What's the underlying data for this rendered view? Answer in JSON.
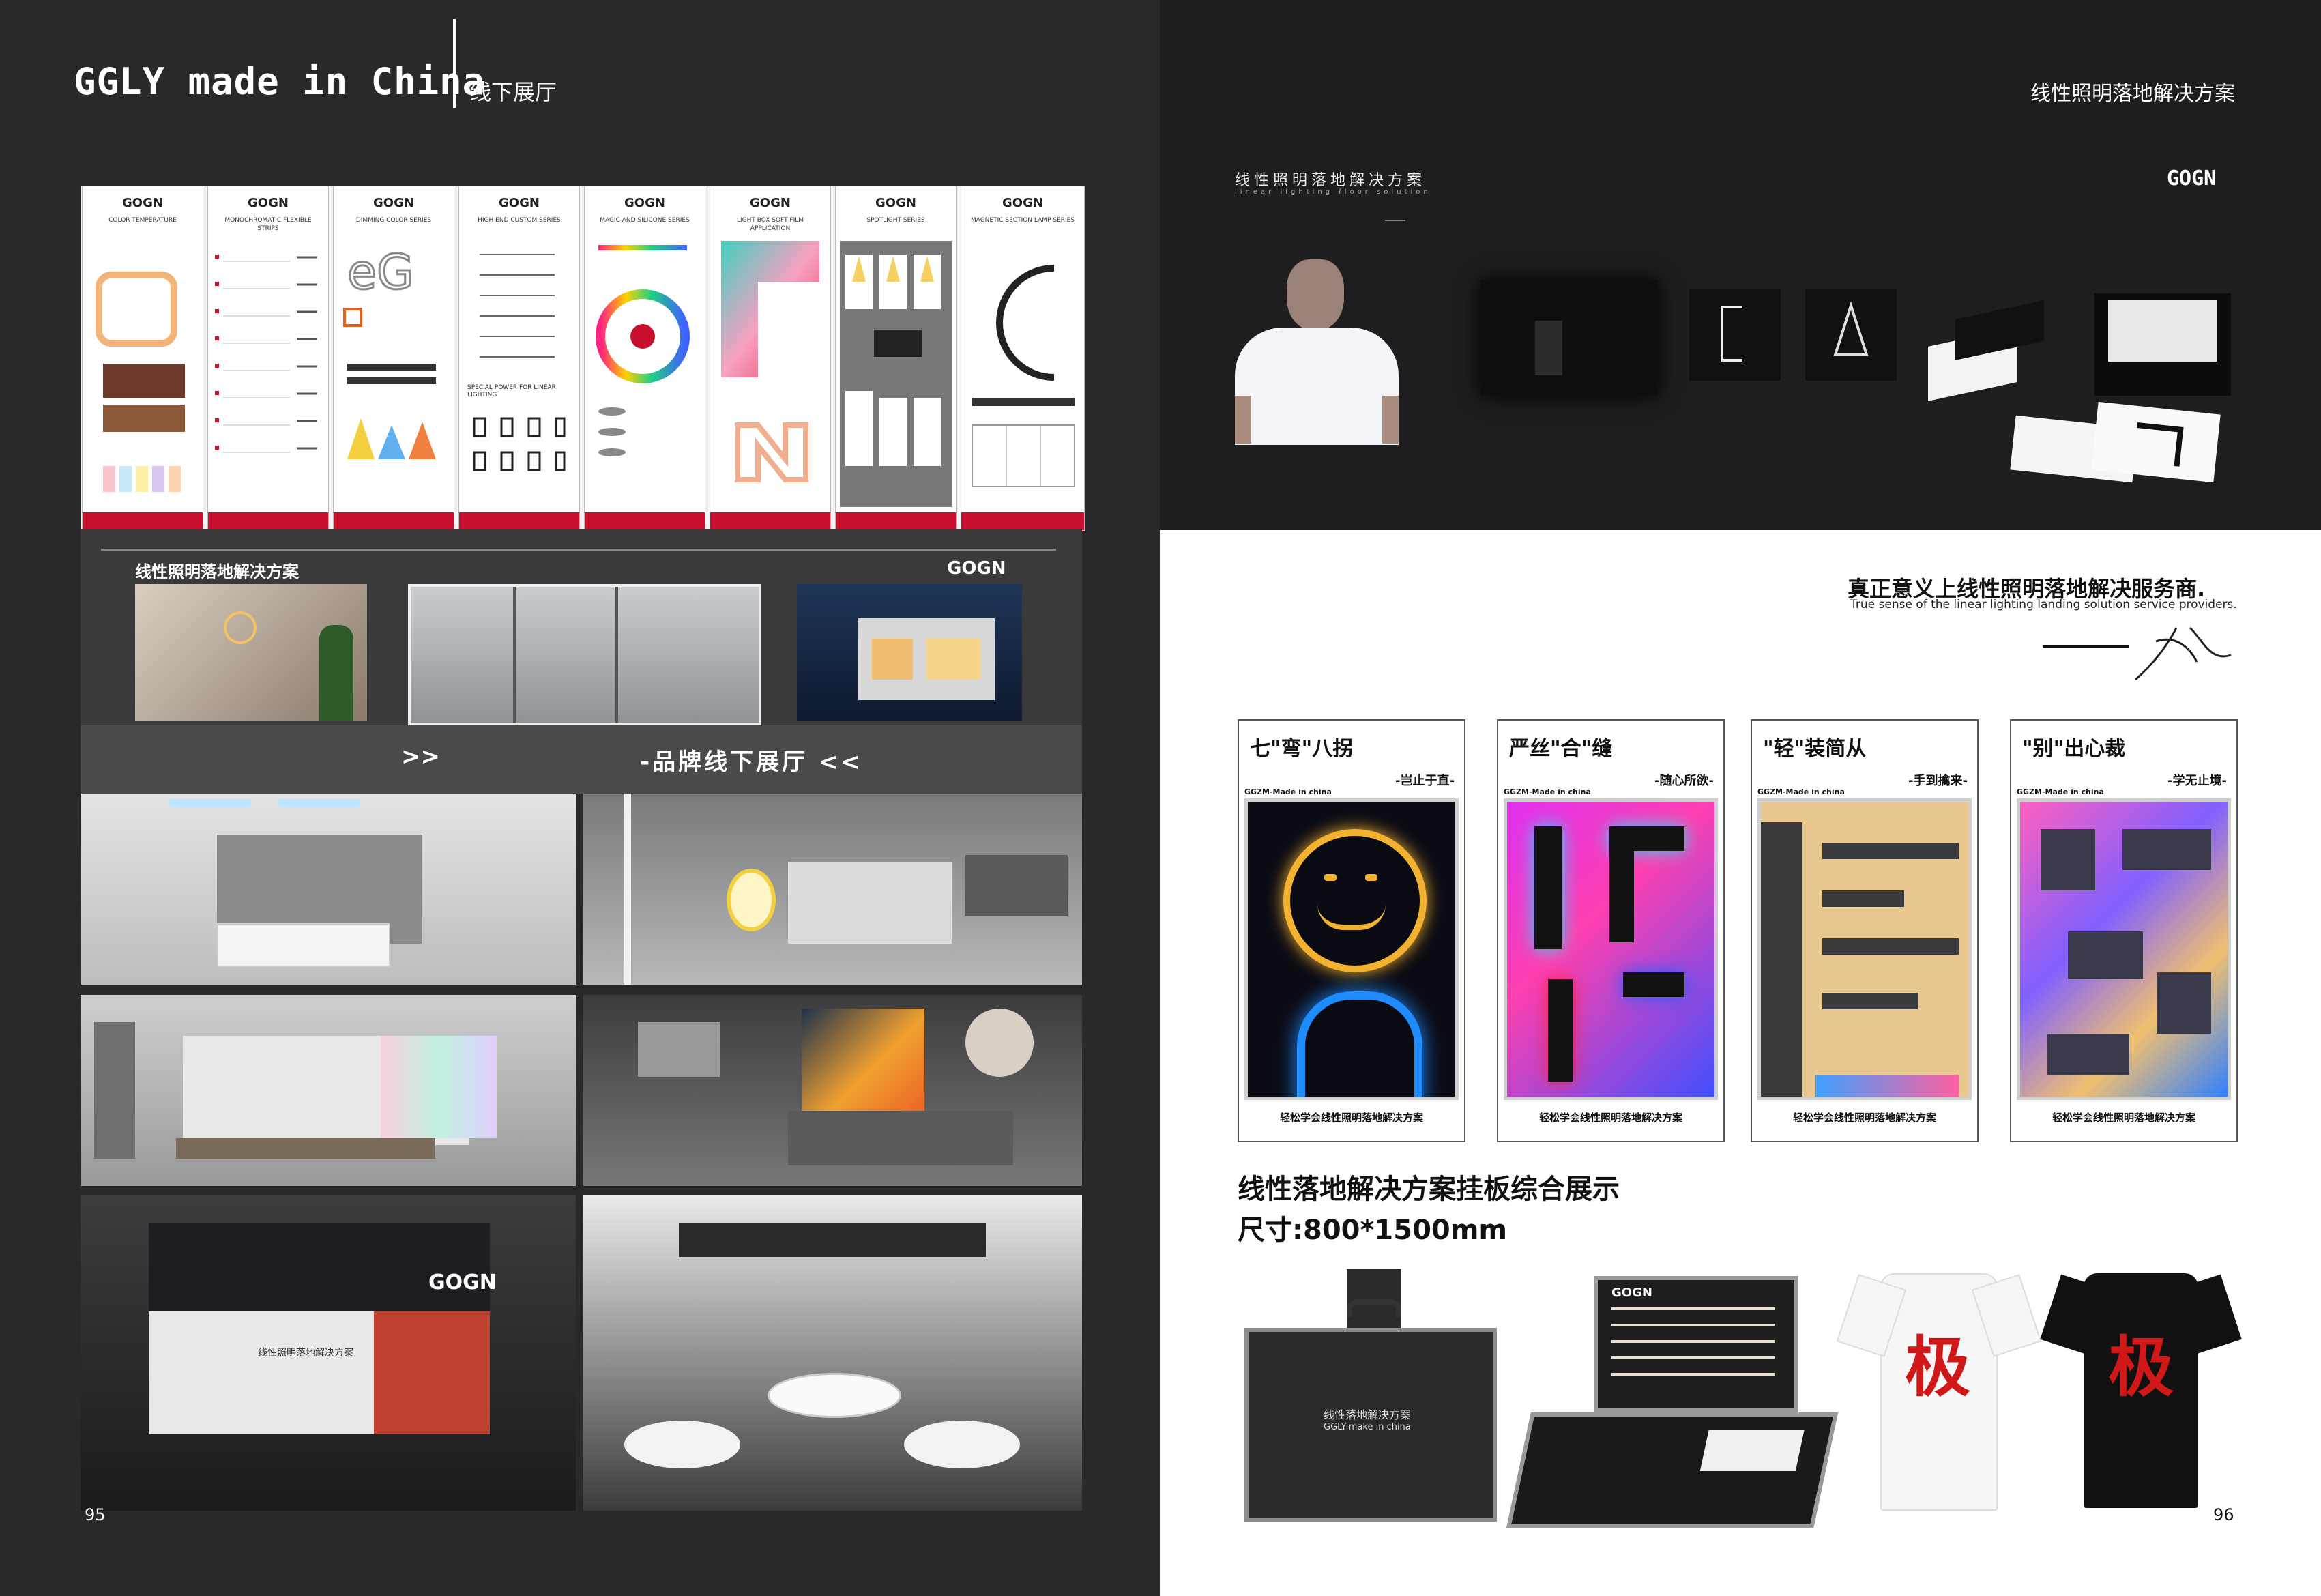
{
  "left_page": {
    "brand_title": "GGLY made in China",
    "section_label": "线下展厅",
    "page_number": "95",
    "panels": [
      {
        "logo": "GOGN",
        "title": "COLOR TEMPERATURE"
      },
      {
        "logo": "GOGN",
        "title": "MONOCHROMATIC FLEXIBLE STRIPS"
      },
      {
        "logo": "GOGN",
        "title": "DIMMING COLOR SERIES"
      },
      {
        "logo": "GOGN",
        "title": "HIGH END CUSTOM SERIES"
      },
      {
        "logo": "GOGN",
        "title": "MAGIC AND SILICONE SERIES"
      },
      {
        "logo": "GOGN",
        "title": "LIGHT BOX SOFT FILM APPLICATION"
      },
      {
        "logo": "GOGN",
        "title": "SPOTLIGHT SERIES"
      },
      {
        "logo": "GOGN",
        "title": "MAGNETIC SECTION LAMP SERIES"
      }
    ],
    "panel_special_text": "SPECIAL POWER FOR LINEAR LIGHTING",
    "wall_title": "线性照明落地解决方案",
    "wall_logo": "GOGN",
    "banner_left": ">>",
    "banner_text": "-品牌线下展厅 <<",
    "booth_logo": "GOGN",
    "booth_text": "线性照明落地解决方案"
  },
  "right_page": {
    "header_title": "线性照明落地解决方案",
    "promo_title": "线性照明落地解决方案",
    "promo_subtitle": "linear lighting floor solution",
    "promo_logo": "GOGN",
    "slogan_cn": "真正意义上线性照明落地解决服务商.",
    "slogan_en": "True sense of the linear lighting landing solution service providers.",
    "cards": [
      {
        "title": "七\"弯\"八拐",
        "sub": "-岂止于直-",
        "made": "GGZM-Made in china",
        "caption": "轻松学会线性照明落地解决方案"
      },
      {
        "title": "严丝\"合\"缝",
        "sub": "-随心所欲-",
        "made": "GGZM-Made in china",
        "caption": "轻松学会线性照明落地解决方案"
      },
      {
        "title": "\"轻\"装简从",
        "sub": "-手到擒来-",
        "made": "GGZM-Made in china",
        "caption": "轻松学会线性照明落地解决方案"
      },
      {
        "title": "\"别\"出心裁",
        "sub": "-学无止境-",
        "made": "GGZM-Made in china",
        "caption": "轻松学会线性照明落地解决方案"
      }
    ],
    "display_title": "线性落地解决方案挂板综合展示",
    "display_size": "尺寸:800*1500mm",
    "case_text_1": "线性落地解决方案",
    "case_text_2": "GGLY-make in china",
    "case_logo": "GOGN",
    "shirt_char": "极",
    "page_number": "96"
  },
  "colors": {
    "accent_red": "#c8102e",
    "dark_bg": "#29292b",
    "white_page": "#ffffff"
  }
}
